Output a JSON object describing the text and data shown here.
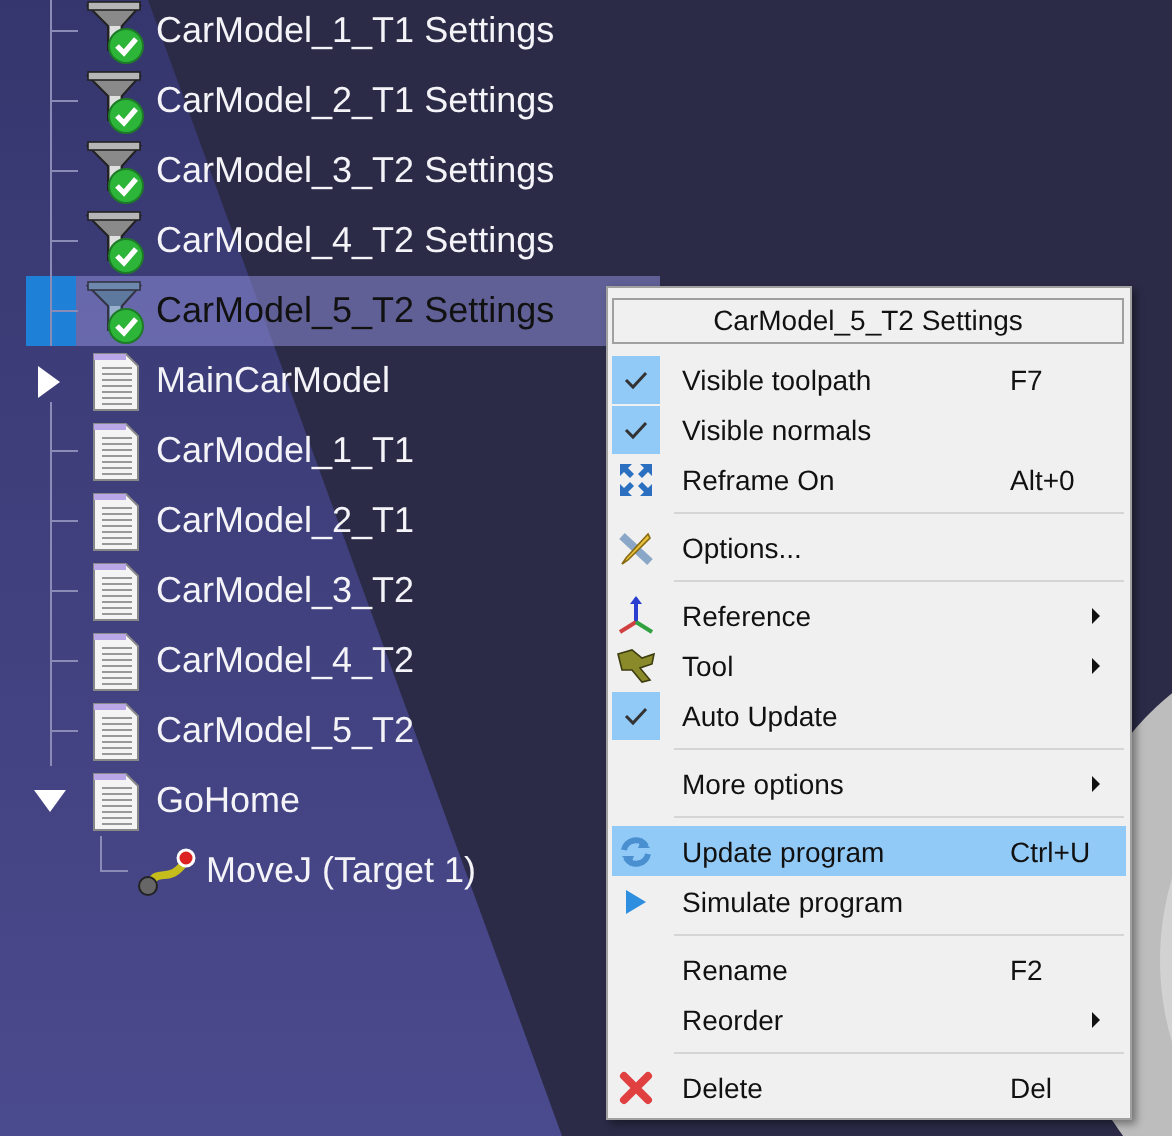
{
  "tree": {
    "items": [
      {
        "kind": "settings",
        "label": "CarModel_1_T1 Settings",
        "selected": false
      },
      {
        "kind": "settings",
        "label": "CarModel_2_T1 Settings",
        "selected": false
      },
      {
        "kind": "settings",
        "label": "CarModel_3_T2 Settings",
        "selected": false
      },
      {
        "kind": "settings",
        "label": "CarModel_4_T2 Settings",
        "selected": false
      },
      {
        "kind": "settings",
        "label": "CarModel_5_T2 Settings",
        "selected": true
      },
      {
        "kind": "program",
        "label": "MainCarModel",
        "selected": false,
        "expanded": false
      },
      {
        "kind": "program",
        "label": "CarModel_1_T1",
        "selected": false
      },
      {
        "kind": "program",
        "label": "CarModel_2_T1",
        "selected": false
      },
      {
        "kind": "program",
        "label": "CarModel_3_T2",
        "selected": false
      },
      {
        "kind": "program",
        "label": "CarModel_4_T2",
        "selected": false
      },
      {
        "kind": "program",
        "label": "CarModel_5_T2",
        "selected": false
      },
      {
        "kind": "program",
        "label": "GoHome",
        "selected": false,
        "expanded": true,
        "children": [
          {
            "kind": "move",
            "label": "MoveJ (Target 1)",
            "selected": false
          }
        ]
      }
    ]
  },
  "context_menu": {
    "title": "CarModel_5_T2 Settings",
    "items": [
      {
        "kind": "item",
        "label": "Visible toolpath",
        "shortcut": "F7",
        "checked": true,
        "submenu": false,
        "selected": false
      },
      {
        "kind": "item",
        "label": "Visible normals",
        "checked": true,
        "submenu": false,
        "selected": false
      },
      {
        "kind": "item",
        "label": "Reframe On",
        "shortcut": "Alt+0",
        "checked": false,
        "submenu": false,
        "selected": false
      },
      {
        "kind": "separator"
      },
      {
        "kind": "item",
        "label": "Options...",
        "checked": false,
        "submenu": false,
        "selected": false
      },
      {
        "kind": "separator"
      },
      {
        "kind": "item",
        "label": "Reference",
        "checked": false,
        "submenu": true,
        "selected": false
      },
      {
        "kind": "item",
        "label": "Tool",
        "checked": false,
        "submenu": true,
        "selected": false
      },
      {
        "kind": "item",
        "label": "Auto Update",
        "checked": true,
        "submenu": false,
        "selected": false
      },
      {
        "kind": "separator"
      },
      {
        "kind": "item",
        "label": "More options",
        "checked": false,
        "submenu": true,
        "selected": false
      },
      {
        "kind": "separator"
      },
      {
        "kind": "item",
        "label": "Update program",
        "shortcut": "Ctrl+U",
        "checked": false,
        "submenu": false,
        "selected": true
      },
      {
        "kind": "item",
        "label": "Simulate program",
        "checked": false,
        "submenu": false,
        "selected": false
      },
      {
        "kind": "separator"
      },
      {
        "kind": "item",
        "label": "Rename",
        "shortcut": "F2",
        "checked": false,
        "submenu": false,
        "selected": false
      },
      {
        "kind": "item",
        "label": "Reorder",
        "checked": false,
        "submenu": true,
        "selected": false
      },
      {
        "kind": "separator"
      },
      {
        "kind": "item",
        "label": "Delete",
        "shortcut": "Del",
        "checked": false,
        "submenu": false,
        "selected": false
      }
    ]
  }
}
